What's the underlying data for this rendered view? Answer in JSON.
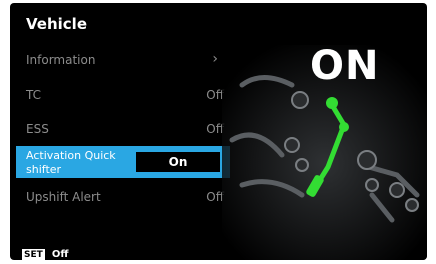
{
  "header": {
    "title": "Vehicle"
  },
  "menu": {
    "items": [
      {
        "label": "Information",
        "value": "›"
      },
      {
        "label": "TC",
        "value": "Off"
      },
      {
        "label": "ESS",
        "value": "Off"
      },
      {
        "label": "Activation Quick shifter",
        "value": "On"
      },
      {
        "label": "Upshift Alert",
        "value": "Off"
      }
    ],
    "selected_index": 3
  },
  "preview": {
    "status": "ON"
  },
  "footer": {
    "badge": "SET",
    "value": "Off"
  },
  "colors": {
    "highlight": "#2aa7e3",
    "shifter": "#33dd33",
    "background": "#000000"
  }
}
